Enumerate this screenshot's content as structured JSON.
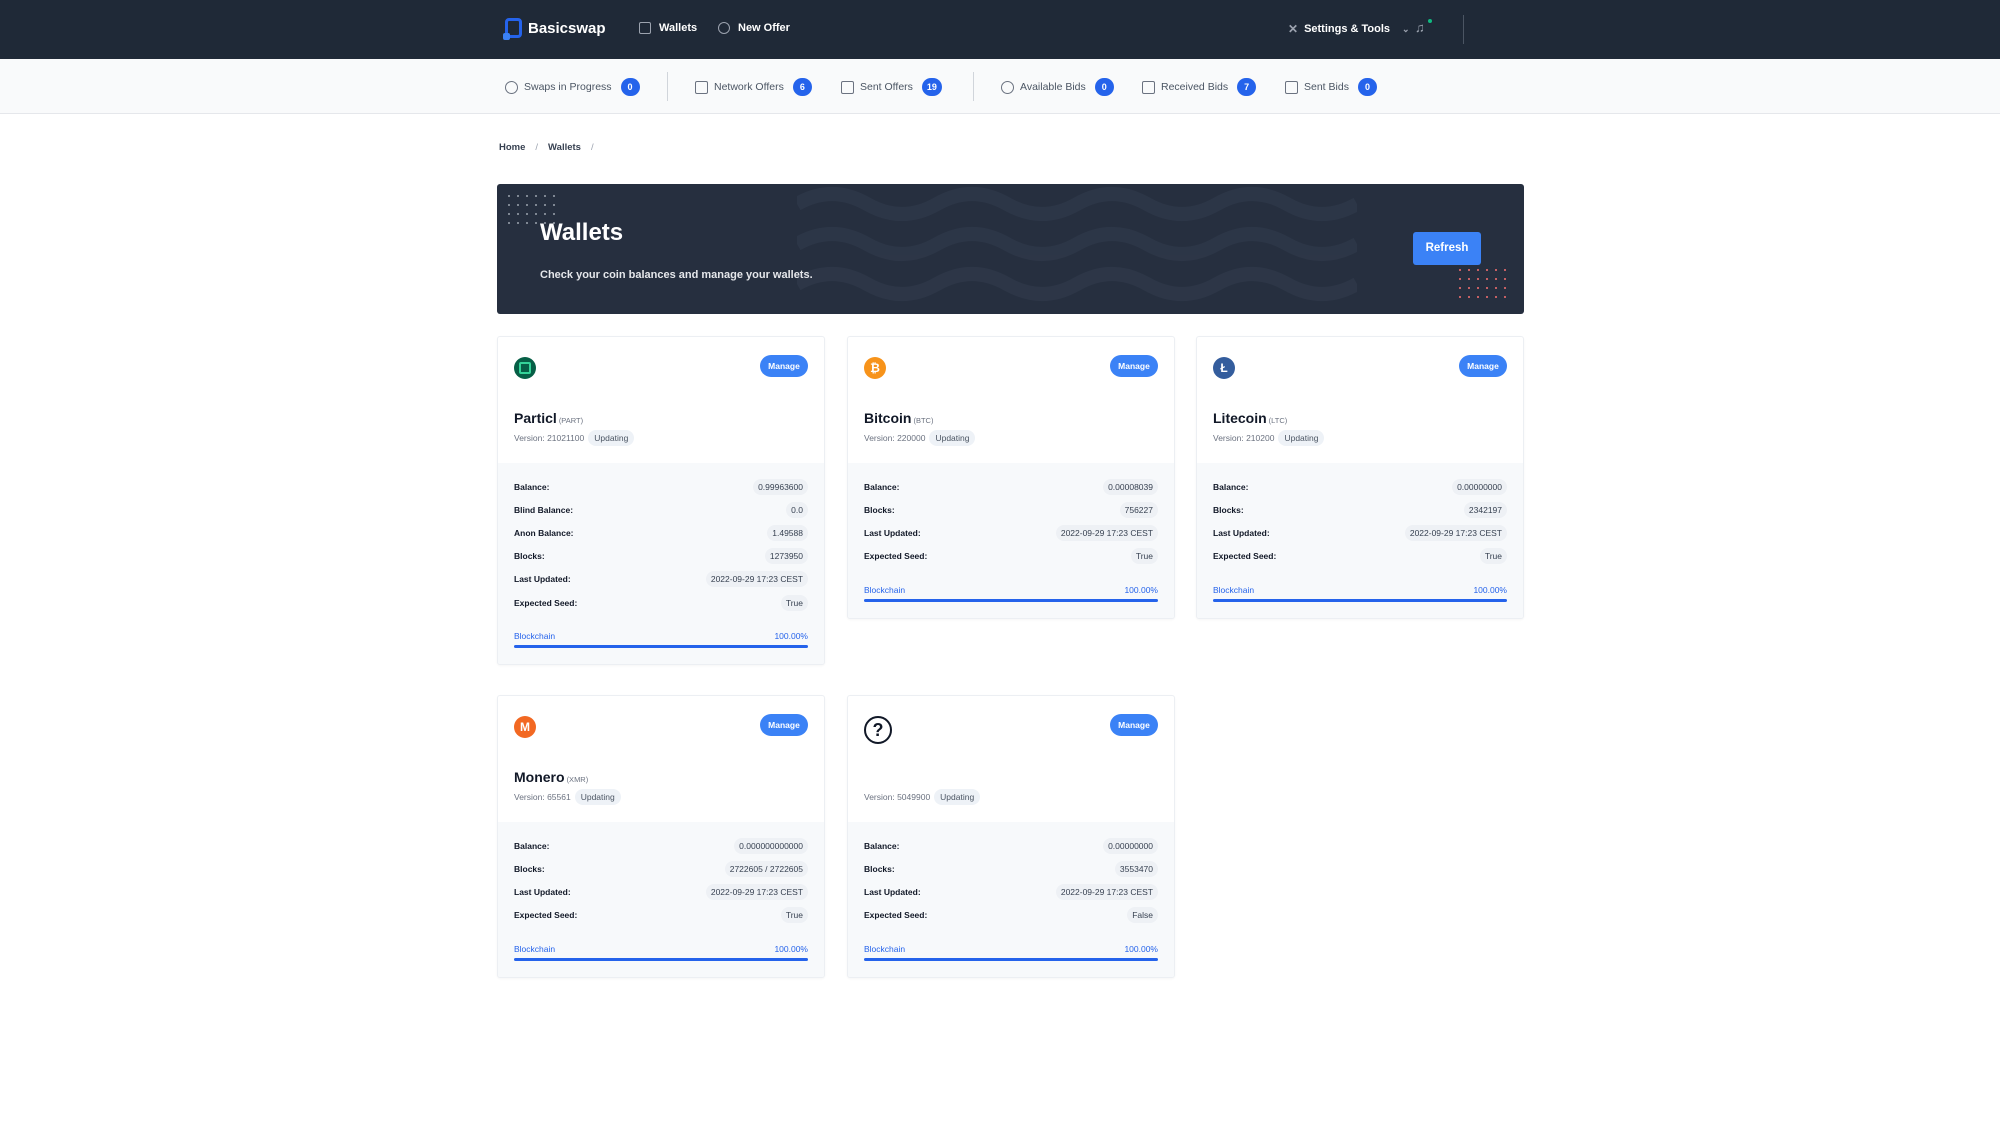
{
  "header": {
    "brand": "Basicswap",
    "nav": [
      {
        "label": "Wallets",
        "icon": "wallet-icon"
      },
      {
        "label": "New Offer",
        "icon": "swap-icon"
      }
    ],
    "settings_label": "Settings & Tools",
    "notifications_icon": "bell-icon"
  },
  "subnav": [
    {
      "label": "Swaps in Progress",
      "count": "0",
      "icon": "refresh-icon"
    },
    {
      "label": "Network Offers",
      "count": "6",
      "icon": "document-icon"
    },
    {
      "label": "Sent Offers",
      "count": "19",
      "icon": "swap-icon"
    },
    {
      "label": "Available Bids",
      "count": "0",
      "icon": "clock-icon"
    },
    {
      "label": "Received Bids",
      "count": "7",
      "icon": "download-icon"
    },
    {
      "label": "Sent Bids",
      "count": "0",
      "icon": "upload-icon"
    }
  ],
  "breadcrumb": [
    "Home",
    "Wallets"
  ],
  "hero": {
    "title": "Wallets",
    "subtitle": "Check your coin balances and manage your wallets.",
    "refresh_label": "Refresh"
  },
  "accent": "#3b82f6",
  "wallets": [
    {
      "name": "Particl",
      "ticker": "(PART)",
      "version": "Version: 21021100",
      "status": "Updating",
      "manage": "Manage",
      "icon": "particl-icon",
      "color": "#065f46",
      "rows": [
        {
          "label": "Balance:",
          "value": "0.99963600"
        },
        {
          "label": "Blind Balance:",
          "value": "0.0"
        },
        {
          "label": "Anon Balance:",
          "value": "1.49588"
        },
        {
          "label": "Blocks:",
          "value": "1273950"
        },
        {
          "label": "Last Updated:",
          "value": "2022-09-29 17:23 CEST"
        },
        {
          "label": "Expected Seed:",
          "value": "True"
        }
      ],
      "sync_label": "Blockchain",
      "sync_text": "100.00%",
      "sync": 1.0
    },
    {
      "name": "Bitcoin",
      "ticker": "(BTC)",
      "version": "Version: 220000",
      "status": "Updating",
      "manage": "Manage",
      "icon": "bitcoin-icon",
      "color": "#f7931a",
      "rows": [
        {
          "label": "Balance:",
          "value": "0.00008039"
        },
        {
          "label": "Blocks:",
          "value": "756227"
        },
        {
          "label": "Last Updated:",
          "value": "2022-09-29 17:23 CEST"
        },
        {
          "label": "Expected Seed:",
          "value": "True"
        }
      ],
      "sync_label": "Blockchain",
      "sync_text": "100.00%",
      "sync": 1.0
    },
    {
      "name": "Litecoin",
      "ticker": "(LTC)",
      "version": "Version: 210200",
      "status": "Updating",
      "manage": "Manage",
      "icon": "litecoin-icon",
      "color": "#345d9d",
      "rows": [
        {
          "label": "Balance:",
          "value": "0.00000000"
        },
        {
          "label": "Blocks:",
          "value": "2342197"
        },
        {
          "label": "Last Updated:",
          "value": "2022-09-29 17:23 CEST"
        },
        {
          "label": "Expected Seed:",
          "value": "True"
        }
      ],
      "sync_label": "Blockchain",
      "sync_text": "100.00%",
      "sync": 1.0
    },
    {
      "name": "Monero",
      "ticker": "(XMR)",
      "version": "Version: 65561",
      "status": "Updating",
      "manage": "Manage",
      "icon": "monero-icon",
      "color": "#f26822",
      "rows": [
        {
          "label": "Balance:",
          "value": "0.000000000000"
        },
        {
          "label": "Blocks:",
          "value": "2722605 / 2722605"
        },
        {
          "label": "Last Updated:",
          "value": "2022-09-29 17:23 CEST"
        },
        {
          "label": "Expected Seed:",
          "value": "True"
        }
      ],
      "sync_label": "Blockchain",
      "sync_text": "100.00%",
      "sync": 1.0
    },
    {
      "name": "",
      "ticker": "",
      "version": "Version: 5049900",
      "status": "Updating",
      "manage": "Manage",
      "icon": "unknown-coin-icon",
      "color": "#111827",
      "rows": [
        {
          "label": "Balance:",
          "value": "0.00000000"
        },
        {
          "label": "Blocks:",
          "value": "3553470"
        },
        {
          "label": "Last Updated:",
          "value": "2022-09-29 17:23 CEST"
        },
        {
          "label": "Expected Seed:",
          "value": "False"
        }
      ],
      "sync_label": "Blockchain",
      "sync_text": "100.00%",
      "sync": 1.0
    }
  ]
}
